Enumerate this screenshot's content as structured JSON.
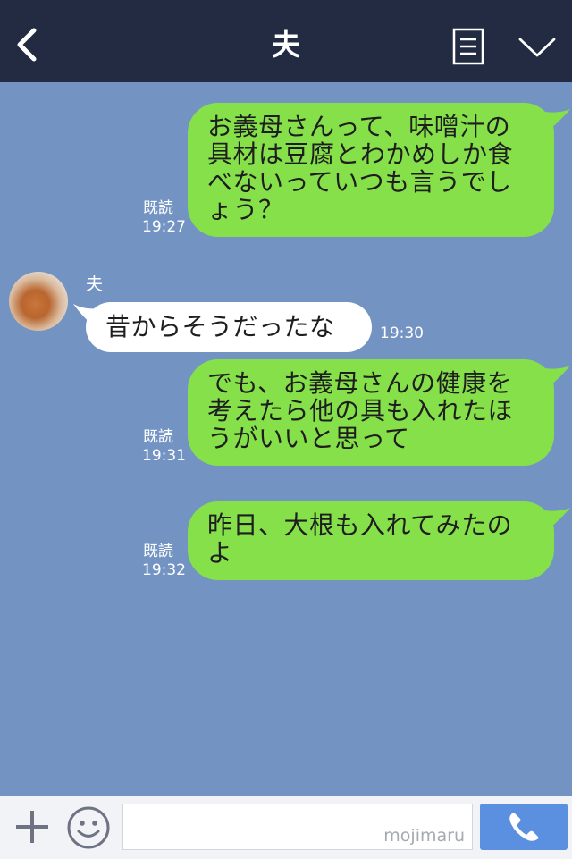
{
  "header": {
    "title": "夫",
    "back_icon": "chevron-left-icon",
    "menu_icon": "notes-icon",
    "dropdown_icon": "chevron-down-icon"
  },
  "messages": [
    {
      "direction": "outgoing",
      "lines": [
        "お義母さんって、味噌汁の",
        "具材は豆腐とわかめしか食",
        "べないっていつも言うでし",
        "ょう？"
      ],
      "read_label": "既読",
      "time": "19:27"
    },
    {
      "direction": "incoming",
      "sender": "夫",
      "lines": [
        "昔からそうだったな"
      ],
      "time": "19:30"
    },
    {
      "direction": "outgoing",
      "lines": [
        "でも、お義母さんの健康を",
        "考えたら他の具も入れたほ",
        "うがいいと思って"
      ],
      "read_label": "既読",
      "time": "19:31"
    },
    {
      "direction": "outgoing",
      "lines": [
        "昨日、大根も入れてみたの",
        "よ"
      ],
      "read_label": "既読",
      "time": "19:32"
    }
  ],
  "footer": {
    "input_value": "",
    "watermark": "mojimaru",
    "plus_icon": "plus-icon",
    "emoji_icon": "smiley-icon",
    "call_icon": "phone-icon"
  },
  "colors": {
    "header_bg": "#222b42",
    "chat_bg": "#7394c3",
    "outgoing_bubble": "#86e04a",
    "incoming_bubble": "#ffffff",
    "call_button": "#5b8fe0"
  }
}
